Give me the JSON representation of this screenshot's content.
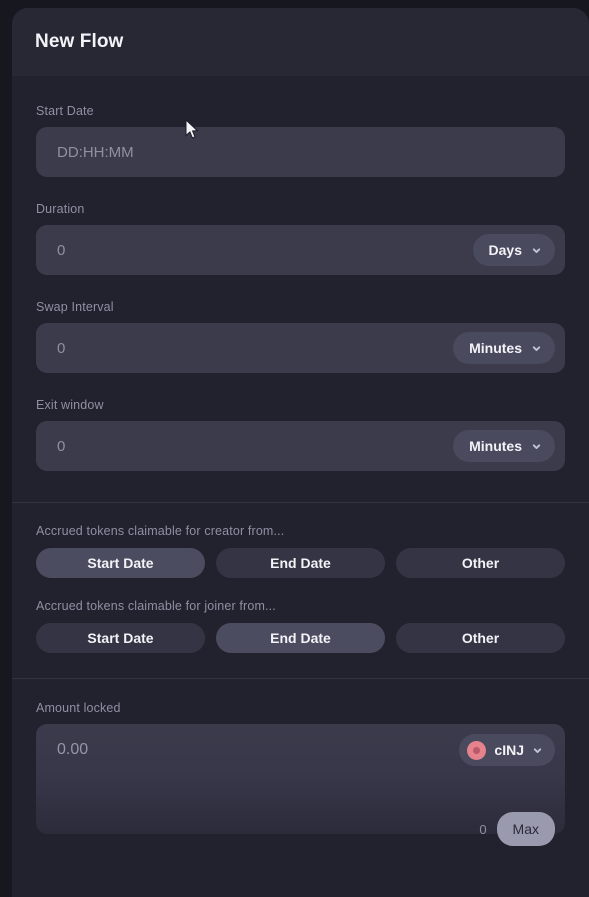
{
  "header": {
    "title": "New Flow"
  },
  "fields": {
    "start_date": {
      "label": "Start Date",
      "placeholder": "DD:HH:MM"
    },
    "duration": {
      "label": "Duration",
      "value": "0",
      "unit": "Days",
      "unit_icon": "chevron-down-icon"
    },
    "swap_interval": {
      "label": "Swap Interval",
      "value": "0",
      "unit": "Minutes",
      "unit_icon": "chevron-down-icon"
    },
    "exit_window": {
      "label": "Exit window",
      "value": "0",
      "unit": "Minutes",
      "unit_icon": "chevron-down-icon"
    }
  },
  "creator_claim": {
    "label": "Accrued tokens claimable for creator from...",
    "options": [
      {
        "label": "Start Date",
        "selected": true
      },
      {
        "label": "End Date",
        "selected": false
      },
      {
        "label": "Other",
        "selected": false
      }
    ]
  },
  "joiner_claim": {
    "label": "Accrued tokens claimable for joiner from...",
    "options": [
      {
        "label": "Start Date",
        "selected": false
      },
      {
        "label": "End Date",
        "selected": true
      },
      {
        "label": "Other",
        "selected": false
      }
    ]
  },
  "amount_locked": {
    "label": "Amount locked",
    "placeholder": "0.00",
    "token_symbol": "cINJ",
    "token_icon": "cinj-token-icon",
    "token_icon_color": "#e6828c",
    "dropdown_icon": "chevron-down-icon",
    "balance": "0",
    "max_label": "Max"
  },
  "theme": {
    "card_bg": "#22222e",
    "header_bg": "#282835",
    "input_bg": "#3b3b4c",
    "pill_bg": "#4a4a5e",
    "selected_bg": "#4c4c60",
    "unselected_bg": "#343444",
    "label_color": "#8e90a3",
    "text_color": "#f2f3f7"
  }
}
